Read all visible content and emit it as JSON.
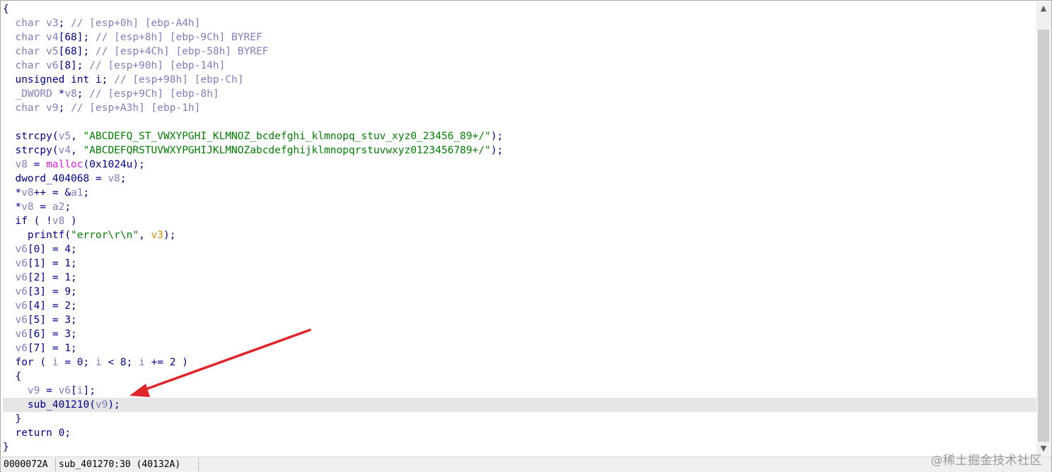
{
  "code": {
    "highlighted_line": 28,
    "lines": [
      "{",
      "  char v3; // [esp+0h] [ebp-A4h]",
      "  char v4[68]; // [esp+8h] [ebp-9Ch] BYREF",
      "  char v5[68]; // [esp+4Ch] [ebp-58h] BYREF",
      "  char v6[8]; // [esp+90h] [ebp-14h]",
      "  unsigned int i; // [esp+98h] [ebp-Ch]",
      "  _DWORD *v8; // [esp+9Ch] [ebp-8h]",
      "  char v9; // [esp+A3h] [ebp-1h]",
      "",
      "  strcpy(v5, \"ABCDEFQ_ST_VWXYPGHI_KLMNOZ_bcdefghi_klmnopq_stuv_xyz0_23456_89+/\");",
      "  strcpy(v4, \"ABCDEFQRSTUVWXYPGHIJKLMNOZabcdefghijklmnopqrstuvwxyz0123456789+/\");",
      "  v8 = malloc(0x1024u);",
      "  dword_404068 = v8;",
      "  *v8++ = &a1;",
      "  *v8 = a2;",
      "  if ( !v8 )",
      "    printf(\"error\\r\\n\", v3);",
      "  v6[0] = 4;",
      "  v6[1] = 1;",
      "  v6[2] = 1;",
      "  v6[3] = 9;",
      "  v6[4] = 2;",
      "  v6[5] = 3;",
      "  v6[6] = 3;",
      "  v6[7] = 1;",
      "  for ( i = 0; i < 8; i += 2 )",
      "  {",
      "    v9 = v6[i];",
      "    sub_401210(v9);",
      "  }",
      "  return 0;",
      "}"
    ]
  },
  "statusbar": {
    "offset": "0000072A",
    "location": "sub_401270:30 (40132A)"
  },
  "scrollbar": {
    "up_icon": "▲",
    "down_icon": "▼"
  },
  "watermark": "@稀土掘金技术社区",
  "colors": {
    "keyword": "#00008b",
    "variable": "#7f7fbf",
    "string": "#008000",
    "library_function": "#e020e0",
    "highlight_arg": "#e08a00",
    "current_line": "#e6e6e6",
    "annotation_arrow": "#e0262a"
  }
}
